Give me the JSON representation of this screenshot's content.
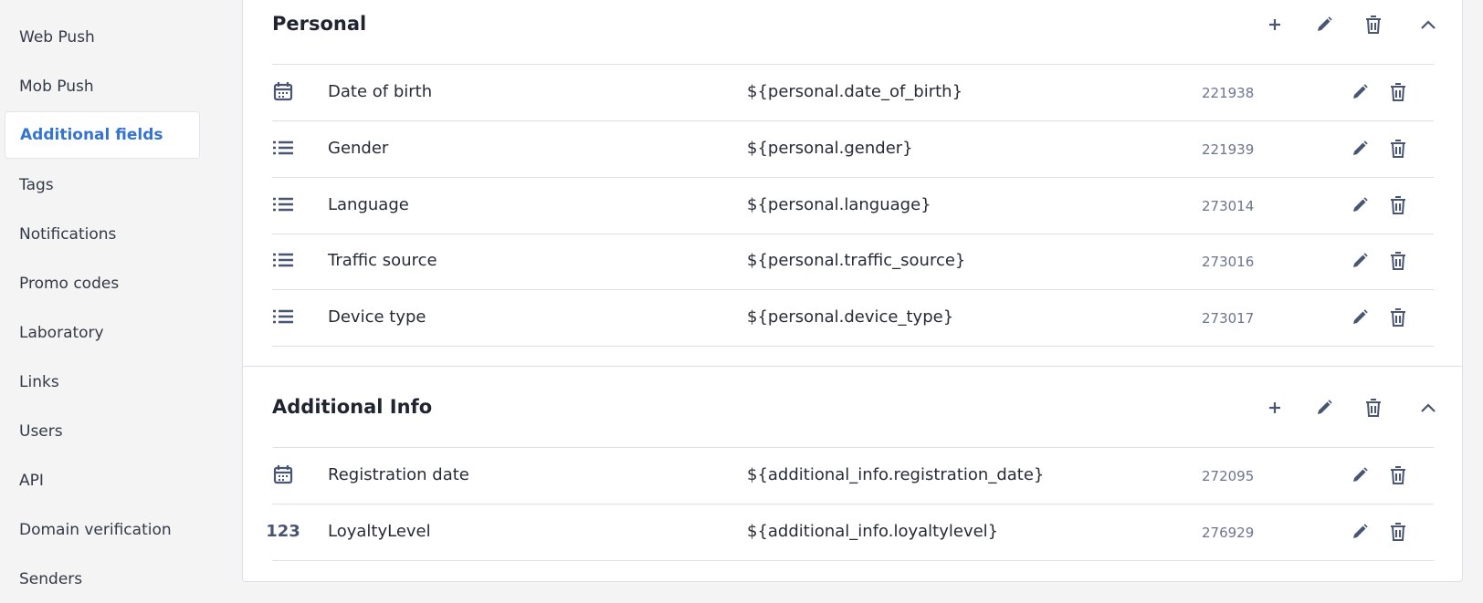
{
  "sidebar": {
    "items": [
      {
        "label": "Web Push",
        "active": false
      },
      {
        "label": "Mob Push",
        "active": false
      },
      {
        "label": "Additional fields",
        "active": true
      },
      {
        "label": "Tags",
        "active": false
      },
      {
        "label": "Notifications",
        "active": false
      },
      {
        "label": "Promo codes",
        "active": false
      },
      {
        "label": "Laboratory",
        "active": false
      },
      {
        "label": "Links",
        "active": false
      },
      {
        "label": "Users",
        "active": false
      },
      {
        "label": "API",
        "active": false
      },
      {
        "label": "Domain verification",
        "active": false
      },
      {
        "label": "Senders",
        "active": false
      }
    ]
  },
  "groups": [
    {
      "title": "Personal",
      "fields": [
        {
          "type_icon": "calendar-icon",
          "name": "Date of birth",
          "variable": "${personal.date_of_birth}",
          "id": "221938"
        },
        {
          "type_icon": "list-icon",
          "name": "Gender",
          "variable": "${personal.gender}",
          "id": "221939"
        },
        {
          "type_icon": "list-icon",
          "name": "Language",
          "variable": "${personal.language}",
          "id": "273014"
        },
        {
          "type_icon": "list-icon",
          "name": "Traffic source",
          "variable": "${personal.traffic_source}",
          "id": "273016"
        },
        {
          "type_icon": "list-icon",
          "name": "Device type",
          "variable": "${personal.device_type}",
          "id": "273017"
        }
      ]
    },
    {
      "title": "Additional Info",
      "fields": [
        {
          "type_icon": "calendar-icon",
          "name": "Registration date",
          "variable": "${additional_info.registration_date}",
          "id": "272095"
        },
        {
          "type_icon": "number-icon",
          "type_label": "123",
          "name": "LoyaltyLevel",
          "variable": "${additional_info.loyaltylevel}",
          "id": "276929"
        }
      ]
    }
  ],
  "colors": {
    "accent": "#3573d3",
    "icon": "#4a5573",
    "border": "#dcdfe6",
    "background": "#f4f4f4"
  }
}
